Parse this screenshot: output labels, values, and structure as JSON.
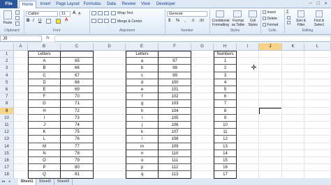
{
  "ribbon_tabs": [
    "File",
    "Home",
    "Insert",
    "Page Layout",
    "Formulas",
    "Data",
    "Review",
    "View",
    "Developer"
  ],
  "ribbon": {
    "paste": "Paste",
    "font_name": "Calibri",
    "font_size": "11",
    "wrap_text": "Wrap Text",
    "merge_center": "Merge & Center",
    "number_format": "General",
    "conditional": "Conditional Formatting",
    "format_table": "Format as Table",
    "cell_styles": "Cell Styles",
    "insert": "Insert",
    "delete": "Delete",
    "format": "Format",
    "sort_filter": "Sort & Filter",
    "find_select": "Find & Select",
    "groups": [
      "Clipboard",
      "Font",
      "Alignment",
      "Number",
      "Styles",
      "Cells",
      "Editing"
    ]
  },
  "formula_bar": {
    "name_box": "J9",
    "fx": "fx",
    "value": ""
  },
  "columns": [
    "A",
    "B",
    "C",
    "D",
    "E",
    "F",
    "G",
    "H",
    "I",
    "J",
    "K",
    "L"
  ],
  "selected_column": "J",
  "rows": [
    "1",
    "2",
    "3",
    "4",
    "5",
    "6",
    "7",
    "8",
    "9",
    "10",
    "11",
    "12",
    "13",
    "14",
    "15",
    "16",
    "17",
    "18"
  ],
  "selected_row": "9",
  "table1": {
    "header": "Letters",
    "letters": [
      "A",
      "B",
      "C",
      "D",
      "E",
      "F",
      "G",
      "H",
      "I",
      "J",
      "K",
      "L",
      "M",
      "N",
      "O",
      "P",
      "Q"
    ],
    "codes": [
      "65",
      "66",
      "67",
      "68",
      "69",
      "70",
      "71",
      "72",
      "73",
      "74",
      "75",
      "76",
      "77",
      "78",
      "79",
      "80",
      "81"
    ]
  },
  "table2": {
    "header": "Letters",
    "letters": [
      "a",
      "b",
      "c",
      "d",
      "e",
      "f",
      "g",
      "h",
      "i",
      "j",
      "k",
      "l",
      "m",
      "n",
      "o",
      "p",
      "q"
    ],
    "codes": [
      "97",
      "98",
      "99",
      "100",
      "101",
      "102",
      "103",
      "104",
      "105",
      "106",
      "107",
      "108",
      "109",
      "110",
      "111",
      "112",
      "113"
    ]
  },
  "table3": {
    "header": "Numbers",
    "values": [
      "1",
      "2",
      "3",
      "4",
      "5",
      "6",
      "7",
      "8",
      "9",
      "10",
      "11",
      "12",
      "13",
      "14",
      "15",
      "16",
      "17"
    ]
  },
  "sheets": [
    "Sheet1",
    "Sheet2",
    "Sheet3"
  ],
  "active_sheet": "Sheet1",
  "colors": {
    "file_tab": "#2b579a",
    "selected_header": "#f8d48a"
  }
}
